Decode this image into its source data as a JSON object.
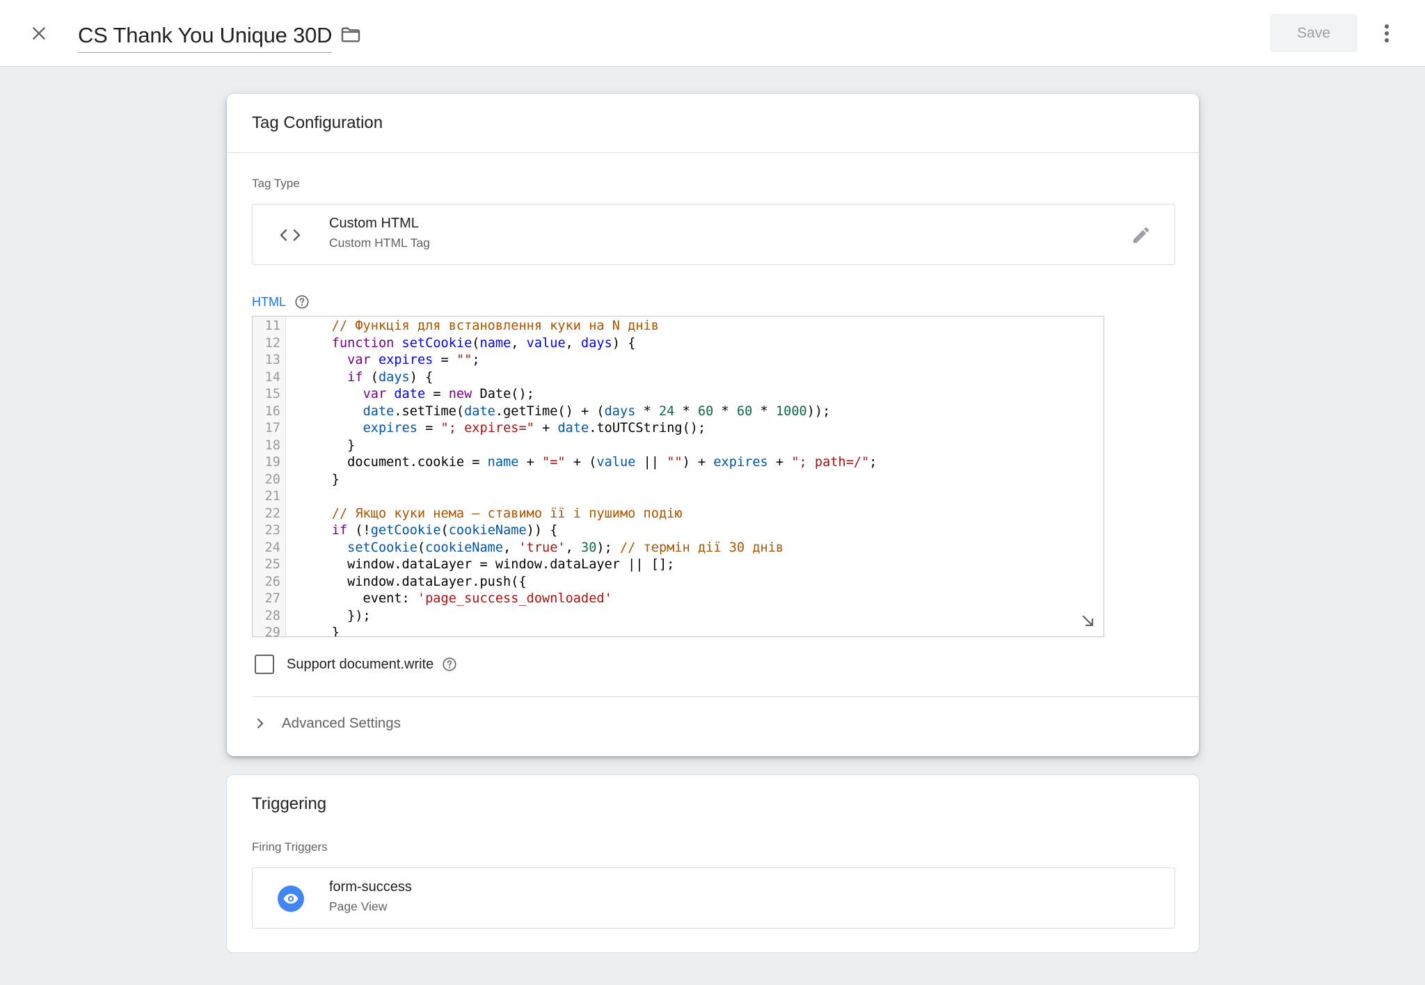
{
  "header": {
    "title": "CS Thank You Unique 30D",
    "save_label": "Save",
    "icons": {
      "close": "close-icon",
      "folder": "folder-icon",
      "more": "more-vert-icon"
    }
  },
  "tag_config": {
    "title": "Tag Configuration",
    "tag_type_label": "Tag Type",
    "tag_type": {
      "name": "Custom HTML",
      "description": "Custom HTML Tag",
      "icon": "code-brackets-icon",
      "edit_icon": "pencil-icon"
    },
    "html_label": "HTML",
    "code_lines": [
      {
        "n": "11",
        "tokens": [
          [
            "",
            "    "
          ],
          [
            "com",
            "// Функція для встановлення куки на N днів"
          ]
        ]
      },
      {
        "n": "12",
        "tokens": [
          [
            "",
            "    "
          ],
          [
            "kw",
            "function"
          ],
          [
            "",
            " "
          ],
          [
            "def",
            "setCookie"
          ],
          [
            "",
            "("
          ],
          [
            "def",
            "name"
          ],
          [
            "",
            ", "
          ],
          [
            "def",
            "value"
          ],
          [
            "",
            ", "
          ],
          [
            "def",
            "days"
          ],
          [
            "",
            ") {"
          ]
        ]
      },
      {
        "n": "13",
        "tokens": [
          [
            "",
            "      "
          ],
          [
            "kw",
            "var"
          ],
          [
            "",
            " "
          ],
          [
            "def",
            "expires"
          ],
          [
            "",
            " = "
          ],
          [
            "str",
            "\"\""
          ],
          [
            "",
            ";"
          ]
        ]
      },
      {
        "n": "14",
        "tokens": [
          [
            "",
            "      "
          ],
          [
            "kw",
            "if"
          ],
          [
            "",
            " ("
          ],
          [
            "var",
            "days"
          ],
          [
            "",
            ") {"
          ]
        ]
      },
      {
        "n": "15",
        "tokens": [
          [
            "",
            "        "
          ],
          [
            "kw",
            "var"
          ],
          [
            "",
            " "
          ],
          [
            "def",
            "date"
          ],
          [
            "",
            " = "
          ],
          [
            "kw",
            "new"
          ],
          [
            "",
            " Date();"
          ]
        ]
      },
      {
        "n": "16",
        "tokens": [
          [
            "",
            "        "
          ],
          [
            "var",
            "date"
          ],
          [
            "",
            ".setTime("
          ],
          [
            "var",
            "date"
          ],
          [
            "",
            ".getTime() + ("
          ],
          [
            "var",
            "days"
          ],
          [
            "",
            " * "
          ],
          [
            "num",
            "24"
          ],
          [
            "",
            " * "
          ],
          [
            "num",
            "60"
          ],
          [
            "",
            " * "
          ],
          [
            "num",
            "60"
          ],
          [
            "",
            " * "
          ],
          [
            "num",
            "1000"
          ],
          [
            "",
            "));"
          ]
        ]
      },
      {
        "n": "17",
        "tokens": [
          [
            "",
            "        "
          ],
          [
            "var",
            "expires"
          ],
          [
            "",
            " = "
          ],
          [
            "str",
            "\"; expires=\""
          ],
          [
            "",
            " + "
          ],
          [
            "var",
            "date"
          ],
          [
            "",
            ".toUTCString();"
          ]
        ]
      },
      {
        "n": "18",
        "tokens": [
          [
            "",
            "      }"
          ]
        ]
      },
      {
        "n": "19",
        "tokens": [
          [
            "",
            "      document.cookie = "
          ],
          [
            "var",
            "name"
          ],
          [
            "",
            " + "
          ],
          [
            "str",
            "\"=\""
          ],
          [
            "",
            " + ("
          ],
          [
            "var",
            "value"
          ],
          [
            "",
            " || "
          ],
          [
            "str",
            "\"\""
          ],
          [
            "",
            ") + "
          ],
          [
            "var",
            "expires"
          ],
          [
            "",
            " + "
          ],
          [
            "str",
            "\"; path=/\""
          ],
          [
            "",
            ";"
          ]
        ]
      },
      {
        "n": "20",
        "tokens": [
          [
            "",
            "    }"
          ]
        ]
      },
      {
        "n": "21",
        "tokens": [
          [
            "",
            ""
          ]
        ]
      },
      {
        "n": "22",
        "tokens": [
          [
            "",
            "    "
          ],
          [
            "com",
            "// Якщо куки нема — ставимо її і пушимо подію"
          ]
        ]
      },
      {
        "n": "23",
        "tokens": [
          [
            "",
            "    "
          ],
          [
            "kw",
            "if"
          ],
          [
            "",
            " (!"
          ],
          [
            "var",
            "getCookie"
          ],
          [
            "",
            "("
          ],
          [
            "var",
            "cookieName"
          ],
          [
            "",
            ")) {"
          ]
        ]
      },
      {
        "n": "24",
        "tokens": [
          [
            "",
            "      "
          ],
          [
            "var",
            "setCookie"
          ],
          [
            "",
            "("
          ],
          [
            "var",
            "cookieName"
          ],
          [
            "",
            ", "
          ],
          [
            "str",
            "'true'"
          ],
          [
            "",
            ", "
          ],
          [
            "num",
            "30"
          ],
          [
            "",
            "); "
          ],
          [
            "com",
            "// термін дії 30 днів"
          ]
        ]
      },
      {
        "n": "25",
        "tokens": [
          [
            "",
            "      window.dataLayer = window.dataLayer || [];"
          ]
        ]
      },
      {
        "n": "26",
        "tokens": [
          [
            "",
            "      window.dataLayer.push({"
          ]
        ]
      },
      {
        "n": "27",
        "tokens": [
          [
            "",
            "        event: "
          ],
          [
            "str",
            "'page_success_downloaded'"
          ]
        ]
      },
      {
        "n": "28",
        "tokens": [
          [
            "",
            "      });"
          ]
        ]
      },
      {
        "n": "29",
        "tokens": [
          [
            "",
            "    }"
          ]
        ]
      }
    ],
    "support_docwrite_label": "Support document.write",
    "support_docwrite_checked": false,
    "advanced_settings_label": "Advanced Settings"
  },
  "triggering": {
    "title": "Triggering",
    "firing_label": "Firing Triggers",
    "trigger": {
      "name": "form-success",
      "type": "Page View",
      "icon": "eye-icon",
      "icon_color": "#4285f4"
    }
  },
  "colors": {
    "accent": "#1a73e8",
    "background": "#eceff1"
  }
}
